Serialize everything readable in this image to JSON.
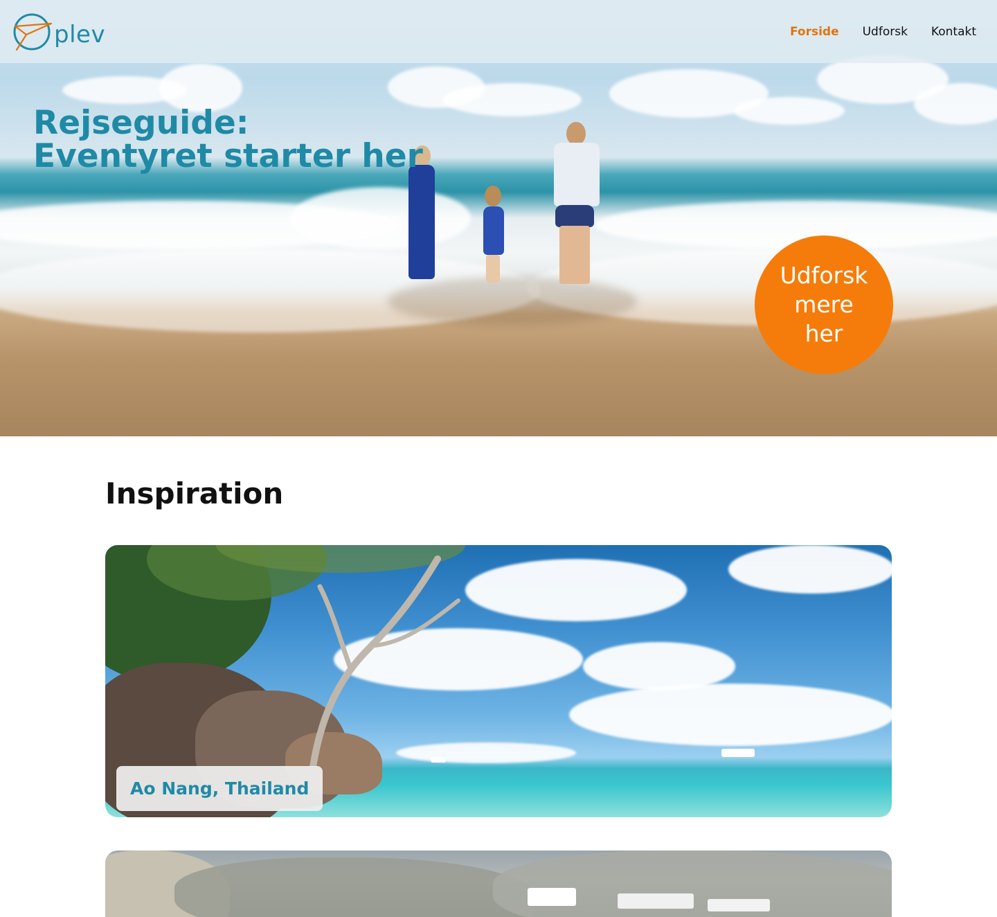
{
  "brand": {
    "name": "plev",
    "accent": "#1f8aa6",
    "orange": "#f57c0a"
  },
  "nav": {
    "items": [
      {
        "label": "Forside",
        "active": true
      },
      {
        "label": "Udforsk",
        "active": false
      },
      {
        "label": "Kontakt",
        "active": false
      }
    ]
  },
  "hero": {
    "title_line1": "Rejseguide:",
    "title_line2": "Eventyret starter her",
    "cta_line1": "Udforsk",
    "cta_line2": "mere",
    "cta_line3": "her"
  },
  "inspiration": {
    "title": "Inspiration",
    "cards": [
      {
        "label": "Ao Nang, Thailand"
      },
      {
        "label": ""
      }
    ]
  }
}
